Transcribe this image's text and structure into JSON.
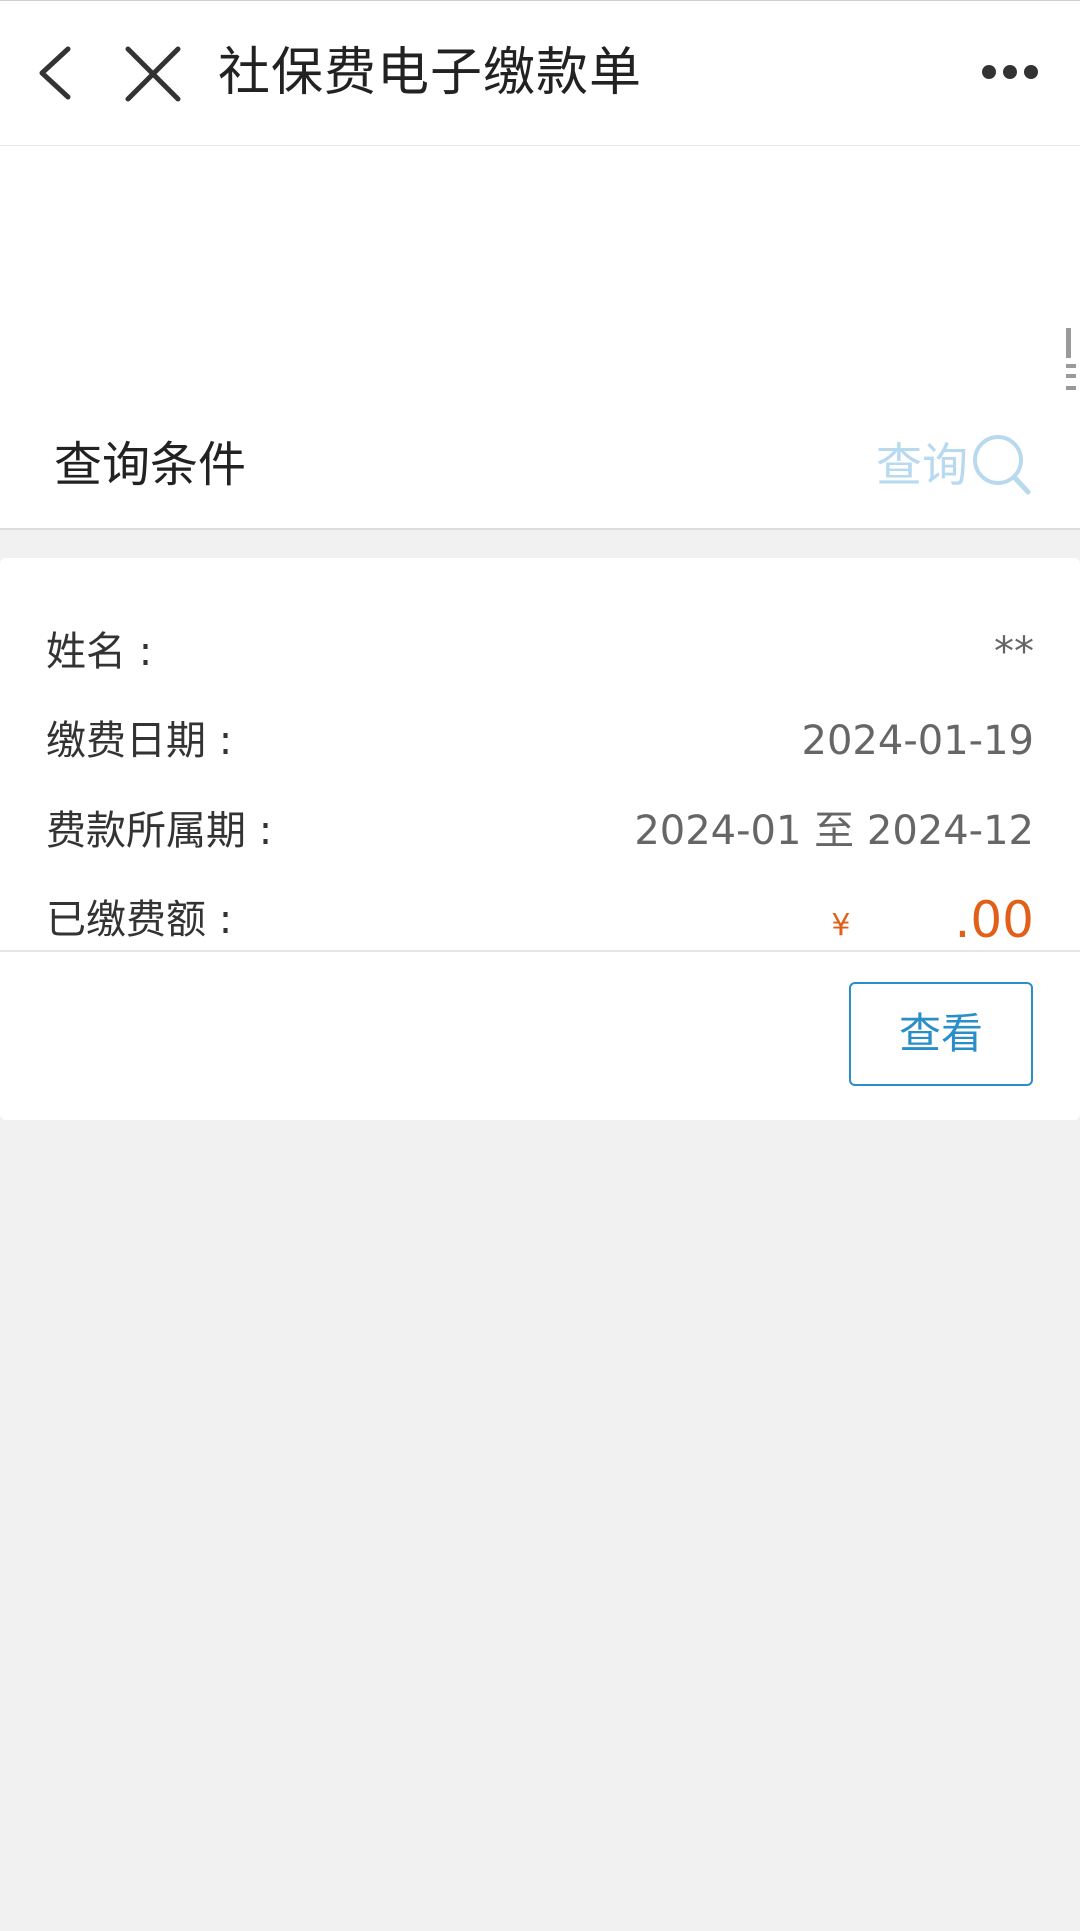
{
  "header": {
    "title": "社保费电子缴款单",
    "back_icon": "chevron-left-icon",
    "close_icon": "close-icon",
    "more_icon": "more-horizontal-icon"
  },
  "query": {
    "label": "查询条件",
    "button_label": "查询",
    "button_icon": "search-icon",
    "button_color": "#b9d9ee"
  },
  "record": {
    "fields": [
      {
        "label": "姓名 :",
        "value": "**"
      },
      {
        "label": "缴费日期 :",
        "value": "2024-01-19"
      },
      {
        "label": "费款所属期 :",
        "value": "2024-01 至 2024-12"
      },
      {
        "label": "已缴费额 :",
        "currency": "¥",
        "value": ".00"
      }
    ],
    "amount_color": "#e25f1a",
    "view_button_label": "查看",
    "view_button_color": "#2a8ec9"
  }
}
